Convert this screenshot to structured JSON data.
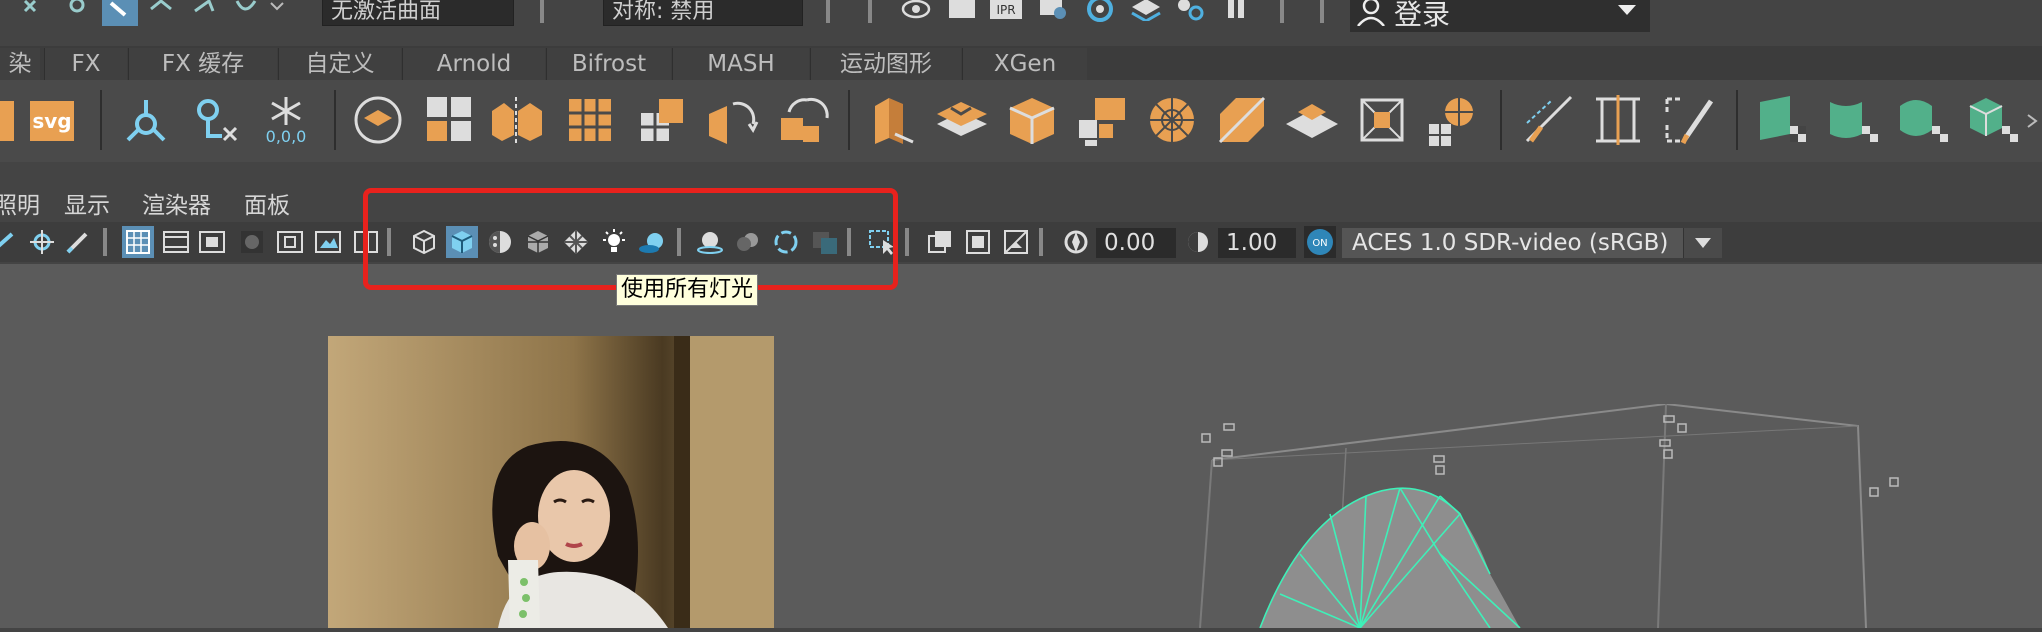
{
  "status_line": {
    "selection_field": "无激活曲面",
    "symmetry_field": "对称: 禁用",
    "login_label": "登录",
    "ipr_label": "IPR"
  },
  "shelf_tabs": [
    "染",
    "FX",
    "FX 缓存",
    "自定义",
    "Arnold",
    "Bifrost",
    "MASH",
    "运动图形",
    "XGen"
  ],
  "shelf": {
    "svg_label": "svg",
    "snowflake_label": "0,0,0"
  },
  "panel_menu": [
    "照明",
    "显示",
    "渲染器",
    "面板"
  ],
  "panel_toolbar": {
    "exposure_value": "0.00",
    "gamma_value": "1.00",
    "on_label": "ON",
    "color_space": "ACES 1.0 SDR-video (sRGB)"
  },
  "tooltip": "使用所有灯光",
  "colors": {
    "highlight_box": "#e8221d",
    "active_button": "#5b8fb5",
    "shelf_orange": "#e8a052",
    "shelf_green": "#52b08a",
    "wire_cyan": "#3ff0b8"
  }
}
